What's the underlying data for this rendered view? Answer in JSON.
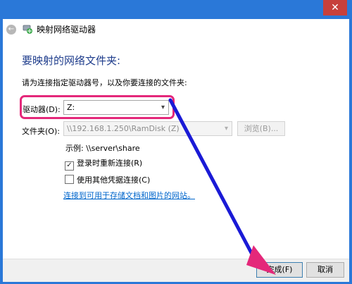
{
  "window": {
    "title": "映射网络驱动器",
    "close_glyph": "✕",
    "back_glyph": "←"
  },
  "heading": "要映射的网络文件夹:",
  "instruction": "请为连接指定驱动器号，以及你要连接的文件夹:",
  "drive": {
    "label": "驱动器(D):",
    "value": "Z:"
  },
  "folder": {
    "label": "文件夹(O):",
    "value": "\\\\192.168.1.250\\RamDisk (Z)",
    "browse_label": "浏览(B)..."
  },
  "example": "示例: \\\\server\\share",
  "reconnect": {
    "label": "登录时重新连接(R)",
    "checked": true
  },
  "other_credentials": {
    "label": "使用其他凭据连接(C)",
    "checked": false
  },
  "link": "连接到可用于存储文档和图片的网站。",
  "buttons": {
    "finish": "完成(F)",
    "cancel": "取消"
  },
  "colors": {
    "title_bar": "#2a78d8",
    "close_button": "#c7403b",
    "heading": "#1f3d8c",
    "highlight": "#e4287a",
    "arrow": "#1a1ad6",
    "link": "#0066cc"
  },
  "icons": {
    "back": "back-arrow-icon",
    "app": "network-drive-icon",
    "close": "close-icon",
    "dropdown": "chevron-down-icon"
  }
}
